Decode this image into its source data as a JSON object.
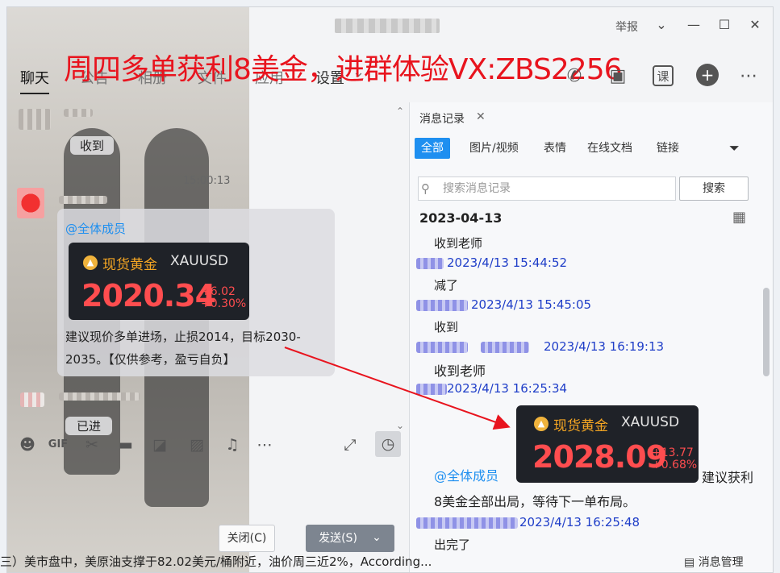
{
  "window": {
    "report_label": "举报",
    "banner_text": "周四多单获利8美金，进群体验VX:ZBS2256"
  },
  "nav": {
    "tabs": [
      "聊天",
      "公告",
      "相册",
      "文件",
      "应用",
      "设置"
    ],
    "settings_arrow": "⌄"
  },
  "header_icons": {
    "course_label": "课"
  },
  "chat": {
    "msg1": "收到",
    "time1": "15:00:13",
    "mention": "@全体成员",
    "card": {
      "name": "现货黄金",
      "symbol": "XAUUSD",
      "price": "2020.34",
      "change_abs": "+6.02",
      "change_pct": "+0.30%"
    },
    "msg_text_line1": "建议现价多单进场，止损2014，目标2030-",
    "msg_text_line2": "2035。【仅供参考，盈亏自负】",
    "msg3": "已进"
  },
  "buttons": {
    "close": "关闭(C)",
    "send": "发送(S)"
  },
  "history": {
    "tab_label": "消息记录",
    "filters": [
      "全部",
      "图片/视频",
      "表情",
      "在线文档",
      "链接"
    ],
    "search_placeholder": "搜索消息记录",
    "search_button": "搜索",
    "date": "2023-04-13",
    "entries": [
      {
        "text": "收到老师",
        "meta": "2023/4/13 15:44:52"
      },
      {
        "text": "减了",
        "meta": "2023/4/13 15:45:05"
      },
      {
        "text": "收到",
        "meta": "2023/4/13 16:19:13"
      },
      {
        "text": "收到老师",
        "meta": "2023/4/13 16:25:34"
      }
    ],
    "card": {
      "name": "现货黄金",
      "symbol": "XAUUSD",
      "price": "2028.09",
      "change_abs": "+13.77",
      "change_pct": "+0.68%"
    },
    "mention": "@全体成员",
    "profit_tail": "建议获利",
    "profit_line2": "8美金全部出局，等待下一单布局。",
    "profit_meta": "2023/4/13 16:25:48",
    "last_text": "出完了",
    "manage_label": "消息管理"
  },
  "footer_text": "三）美市盘中，美原油支撑于82.02美元/桶附近，油价周三近2%，According..."
}
